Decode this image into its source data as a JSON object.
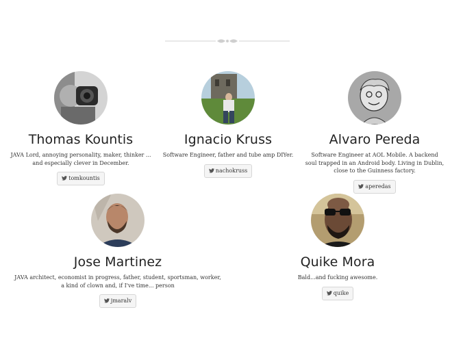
{
  "team": [
    {
      "name": "Thomas Kountis",
      "bio": "JAVA Lord, annoying personality, maker, thinker ... and especially clever in December.",
      "handle": "tomkountis",
      "avatar_colors": [
        "#8a8a8a",
        "#d8d8d8",
        "#2a2a2a"
      ]
    },
    {
      "name": "Ignacio Kruss",
      "bio": "Software Engineer, father and tube amp DIYer.",
      "handle": "nachokruss",
      "avatar_colors": [
        "#a9c4d6",
        "#5f7d3a",
        "#6e6a5e"
      ]
    },
    {
      "name": "Alvaro Pereda",
      "bio": "Software Engineer at AOL Mobile. A backend soul trapped in an Android body. Living in Dublin, close to the Guinness factory.",
      "handle": "aperedas",
      "avatar_colors": [
        "#a0a0a0",
        "#e6e6e6",
        "#3a3a3a"
      ]
    },
    {
      "name": "Jose Martinez",
      "bio": "JAVA architect, economist in progress, father, student, sportsman, worker, a kind of clown and, if I've time... person",
      "handle": "jmaralv",
      "avatar_colors": [
        "#c9c2b8",
        "#b5876c",
        "#2c3d5a"
      ]
    },
    {
      "name": "Quike Mora",
      "bio": "Bald...and fucking awesome.",
      "handle": "quike",
      "avatar_colors": [
        "#b8a070",
        "#6b4a36",
        "#1a1a1a"
      ]
    }
  ],
  "icons": {
    "divider": "ornament-divider-icon",
    "social": "twitter-bird-icon"
  },
  "colors": {
    "button_bg": "#f5f5f5",
    "button_border": "#d6d6d6",
    "text": "#333333"
  }
}
